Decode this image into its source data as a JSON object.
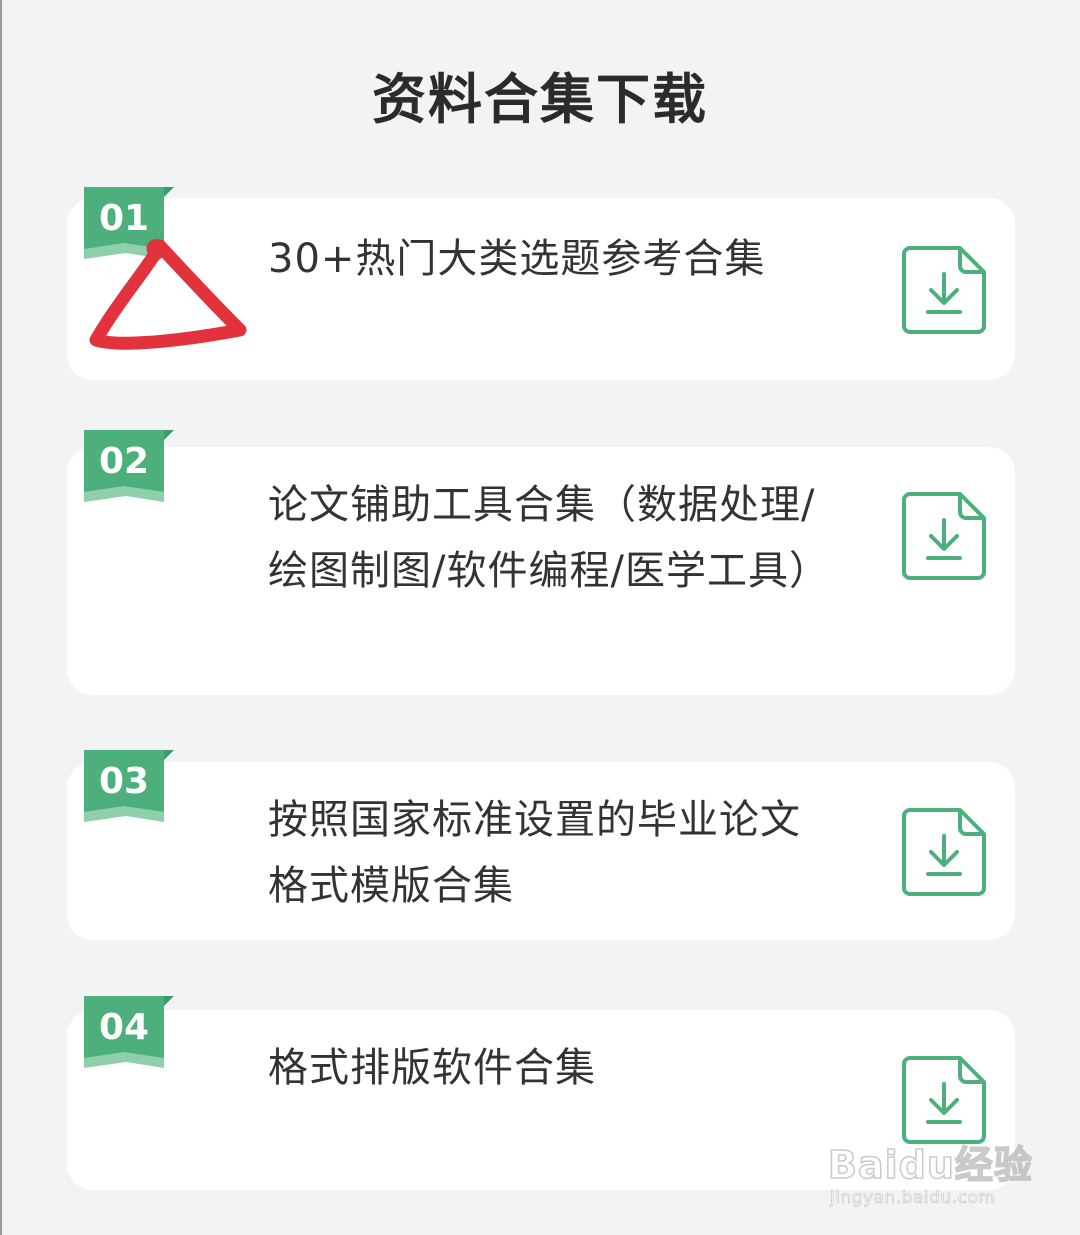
{
  "title": "资料合集下载",
  "colors": {
    "accent": "#4daf7c",
    "accent_dark": "#3f9a6a",
    "accent_light": "#8fcfab",
    "annotation": "#e2323c",
    "card": "#ffffff",
    "background": "#f2f3f4"
  },
  "items": [
    {
      "number": "01",
      "title": "30+热门大类选题参考合集",
      "icon": "download-file-icon"
    },
    {
      "number": "02",
      "title": "论文铺助工具合集（数据处理/绘图制图/软件编程/医学工具）",
      "icon": "download-file-icon"
    },
    {
      "number": "03",
      "title": "按照国家标准设置的毕业论文格式模版合集",
      "icon": "download-file-icon"
    },
    {
      "number": "04",
      "title": "格式排版软件合集",
      "icon": "download-file-icon"
    }
  ],
  "watermark": {
    "brand": "Baidu经验",
    "url": "jingyan.baidu.com"
  }
}
